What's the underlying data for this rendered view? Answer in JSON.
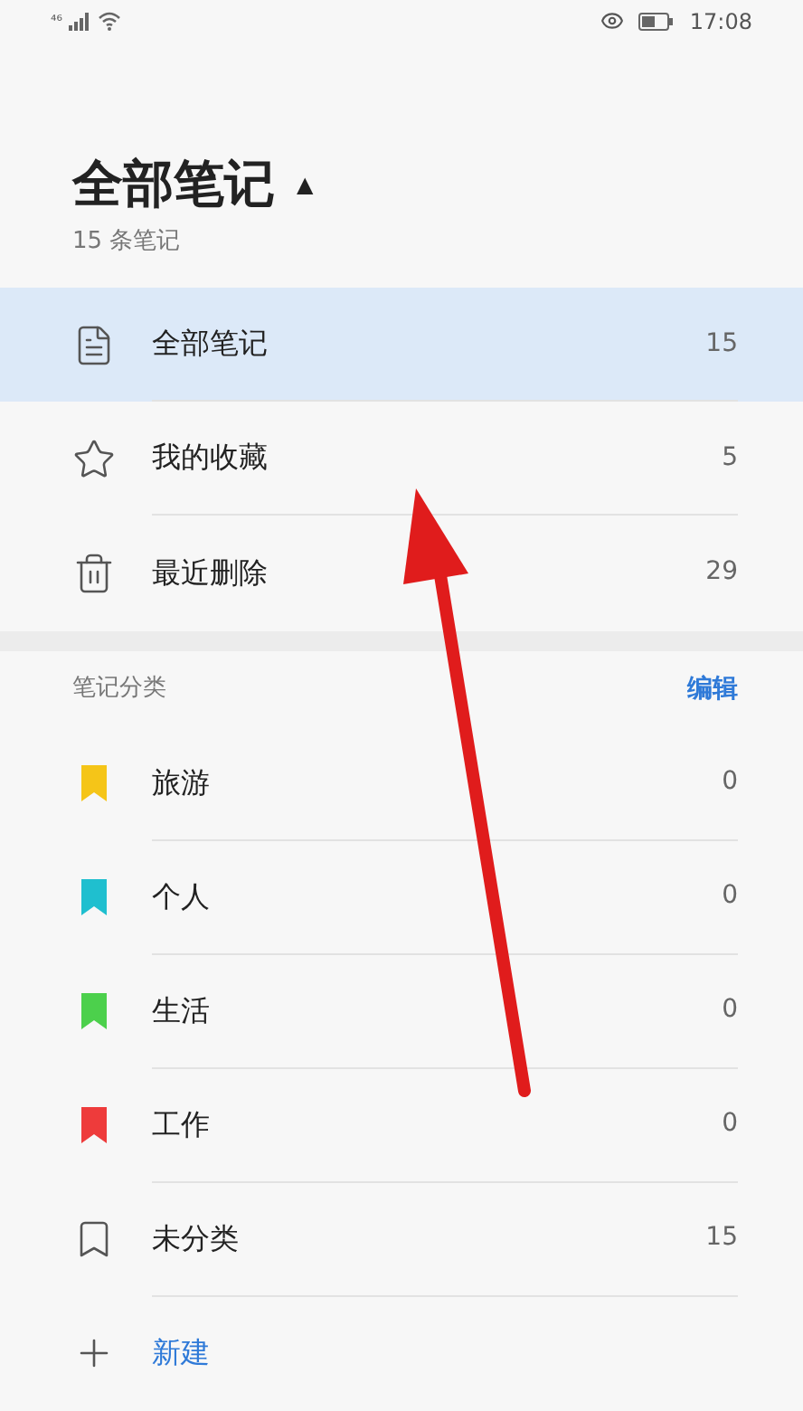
{
  "status_bar": {
    "signal": "⁴⁶",
    "time": "17:08"
  },
  "header": {
    "title": "全部笔记",
    "caret": "▲",
    "subtitle": "15 条笔记"
  },
  "menu": [
    {
      "kind": "note",
      "label": "全部笔记",
      "count": "15",
      "selected": true
    },
    {
      "kind": "star",
      "label": "我的收藏",
      "count": "5",
      "selected": false
    },
    {
      "kind": "trash",
      "label": "最近删除",
      "count": "29",
      "selected": false
    }
  ],
  "categories": {
    "title": "笔记分类",
    "edit": "编辑",
    "items": [
      {
        "kind": "tag",
        "label": "旅游",
        "count": "0",
        "color": "#f5c518"
      },
      {
        "kind": "tag",
        "label": "个人",
        "count": "0",
        "color": "#1fbfcf"
      },
      {
        "kind": "tag",
        "label": "生活",
        "count": "0",
        "color": "#4cd04c"
      },
      {
        "kind": "tag",
        "label": "工作",
        "count": "0",
        "color": "#ee3b3b"
      },
      {
        "kind": "untagged",
        "label": "未分类",
        "count": "15"
      }
    ],
    "new": "新建"
  }
}
